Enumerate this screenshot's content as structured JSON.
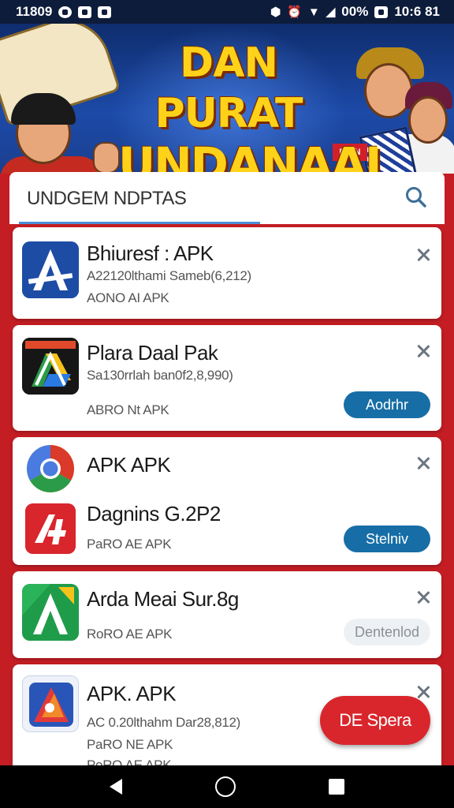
{
  "status_bar": {
    "time": "11809",
    "battery": "00%",
    "clock": "10:6 81"
  },
  "banner": {
    "title_line1": "DAN PURAT",
    "title_line2": "UNDANAAI",
    "badge": "DAIN"
  },
  "search": {
    "text": "UNDGEM NDPTAS"
  },
  "apps": [
    {
      "title": "Bhiuresf : APK",
      "sub1": "A22120lthami Sameb(6,212)",
      "sub2": "AONO AI APK",
      "button": ""
    },
    {
      "title": "Plara Daal Pak",
      "sub1": "Sa130rrlah ban0f2,8,990)",
      "sub2": "ABRO Nt APK",
      "button": "Aodrhr"
    },
    {
      "title": "APK APK",
      "title2": "Dagnins G.2P2",
      "sub2": "PaRO AE APK",
      "button": "Stelniv"
    },
    {
      "title": "Arda Meai Sur.8g",
      "sub2": "RoRO AE APK",
      "button": "Dentenlod"
    },
    {
      "title": "APK. APK",
      "sub1": "AC 0.20lthahm Dar28,812)",
      "sub2": "PaRO NE APK",
      "sub3": "PoRO AE APK"
    }
  ],
  "fab": {
    "label": "DE Spera"
  },
  "colors": {
    "accent": "#176ea6",
    "danger": "#d9262c",
    "background": "#c41e24"
  }
}
